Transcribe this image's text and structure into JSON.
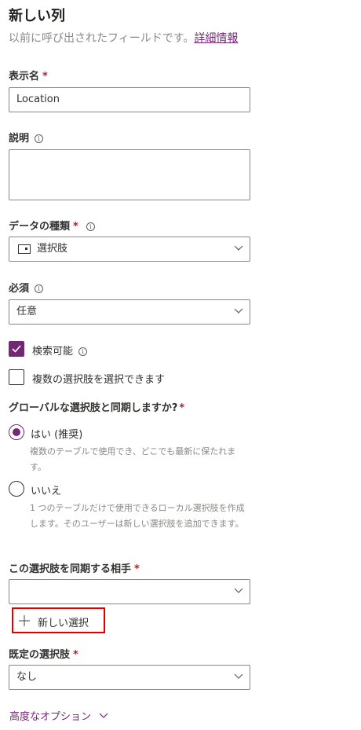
{
  "header": {
    "title": "新しい列",
    "subtitle": "以前に呼び出されたフィールドです。",
    "learn_more": "詳細情報"
  },
  "display_name": {
    "label": "表示名",
    "required_mark": "*",
    "value": "Location"
  },
  "description": {
    "label": "説明",
    "info": "i",
    "value": ""
  },
  "data_type": {
    "label": "データの種類",
    "required_mark": "*",
    "info": "i",
    "icon": "choice-icon",
    "value": "選択肢"
  },
  "required": {
    "label": "必須",
    "info": "i",
    "value": "任意"
  },
  "searchable": {
    "label": "検索可能",
    "info": "i",
    "checked": true
  },
  "multi_select": {
    "label": "複数の選択肢を選択できます",
    "checked": false
  },
  "sync_global": {
    "label": "グローバルな選択肢と同期しますか?",
    "required_mark": "*",
    "options": [
      {
        "label": "はい (推奨)",
        "selected": true,
        "description": "複数のテーブルで使用でき、どこでも最新に保たれます。"
      },
      {
        "label": "いいえ",
        "selected": false,
        "description": "1 つのテーブルだけで使用できるローカル選択肢を作成します。そのユーザーは新しい選択肢を追加できます。"
      }
    ]
  },
  "sync_with": {
    "label": "この選択肢を同期する相手",
    "required_mark": "*",
    "value": ""
  },
  "new_choice": {
    "icon": "plus-icon",
    "label": "新しい選択"
  },
  "default_choice": {
    "label": "既定の選択肢",
    "required_mark": "*",
    "value": "なし"
  },
  "advanced": {
    "label": "高度なオプション",
    "icon": "chevron-down-icon"
  },
  "colors": {
    "accent": "#742774",
    "required": "#a4262c",
    "highlight_border": "#e00000"
  }
}
